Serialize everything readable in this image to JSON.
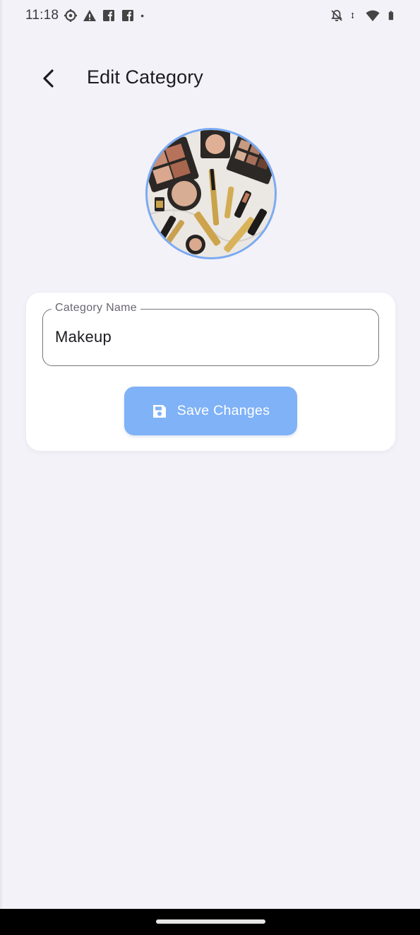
{
  "status_bar": {
    "time": "11:18",
    "left_icons": [
      "settings-gear-icon",
      "warning-icon",
      "facebook-icon",
      "facebook-icon",
      "dot-icon"
    ],
    "right_icons": [
      "notifications-off-icon",
      "data-arrows-icon",
      "wifi-icon",
      "battery-icon"
    ]
  },
  "app_bar": {
    "back_icon": "arrow-back-icon",
    "title": "Edit Category"
  },
  "category": {
    "image": "makeup-products-photo",
    "accent_color": "#7aaaf2"
  },
  "form": {
    "name_label": "Category Name",
    "name_value": "Makeup",
    "save_icon": "save-floppy-icon",
    "save_label": "Save Changes",
    "save_color": "#7fb2f7"
  }
}
